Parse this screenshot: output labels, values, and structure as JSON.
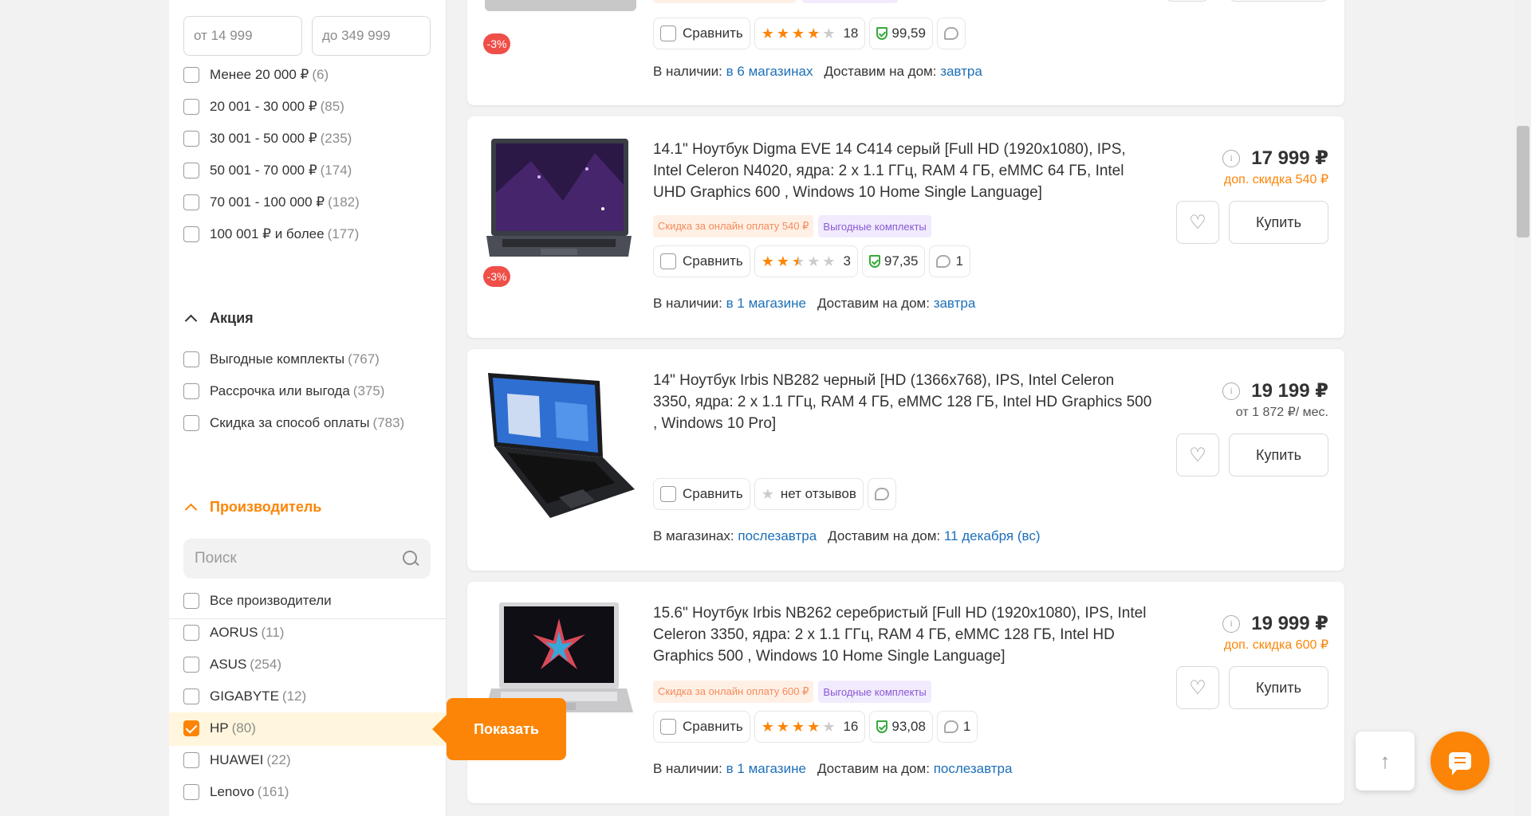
{
  "filters": {
    "price_from_placeholder": "от 14 999",
    "price_to_placeholder": "до 349 999",
    "price_ranges": [
      {
        "label": "Менее 20 000 ₽",
        "count": "(6)"
      },
      {
        "label": "20 001 - 30 000 ₽",
        "count": "(85)"
      },
      {
        "label": "30 001 - 50 000 ₽",
        "count": "(235)"
      },
      {
        "label": "50 001 - 70 000 ₽",
        "count": "(174)"
      },
      {
        "label": "70 001 - 100 000 ₽",
        "count": "(182)"
      },
      {
        "label": "100 001 ₽ и более",
        "count": "(177)"
      }
    ],
    "promo": {
      "title": "Акция",
      "items": [
        {
          "label": "Выгодные комплекты",
          "count": "(767)"
        },
        {
          "label": "Рассрочка или выгода",
          "count": "(375)"
        },
        {
          "label": "Скидка за способ оплаты",
          "count": "(783)"
        }
      ]
    },
    "brand": {
      "title": "Производитель",
      "search_placeholder": "Поиск",
      "all_label": "Все производители",
      "items": [
        {
          "label": "AORUS",
          "count": "(11)",
          "checked": false
        },
        {
          "label": "ASUS",
          "count": "(254)",
          "checked": false
        },
        {
          "label": "GIGABYTE",
          "count": "(12)",
          "checked": false
        },
        {
          "label": "HP",
          "count": "(80)",
          "checked": true
        },
        {
          "label": "HUAWEI",
          "count": "(22)",
          "checked": false
        },
        {
          "label": "Lenovo",
          "count": "(161)",
          "checked": false
        }
      ]
    },
    "show_button": "Показать"
  },
  "products": [
    {
      "discount_badge": "-3%",
      "compare_label": "Сравнить",
      "rating": 4,
      "reviews": "18",
      "reliability": "99,59",
      "availability_prefix": "В наличии:",
      "availability_link": "в 6 магазинах",
      "delivery_prefix": "Доставим на дом:",
      "delivery_link": "завтра"
    },
    {
      "title": "14.1\" Ноутбук Digma EVE 14 C414 серый [Full HD (1920x1080), IPS, Intel Celeron N4020, ядра: 2 х 1.1 ГГц, RAM 4 ГБ, eMMC 64 ГБ, Intel UHD Graphics 600 , Windows 10 Home Single Language]",
      "tag_promo": "Скидка за онлайн оплату 540 ₽",
      "tag_bundle": "Выгодные комплекты",
      "discount_badge": "-3%",
      "compare_label": "Сравнить",
      "rating": 2.5,
      "reviews": "3",
      "reliability": "97,35",
      "comments": "1",
      "availability_prefix": "В наличии:",
      "availability_link": "в 1 магазине",
      "delivery_prefix": "Доставим на дом:",
      "delivery_link": "завтра",
      "price": "17 999 ₽",
      "price_note": "доп. скидка 540 ₽",
      "buy_label": "Купить"
    },
    {
      "title": "14\" Ноутбук Irbis NB282 черный [HD (1366x768), IPS, Intel Celeron 3350, ядра: 2 х 1.1 ГГц, RAM 4 ГБ, eMMC 128 ГБ, Intel HD Graphics 500 , Windows 10 Pro]",
      "compare_label": "Сравнить",
      "no_reviews": "нет отзывов",
      "availability_prefix": "В магазинах:",
      "availability_link": "послезавтра",
      "delivery_prefix": "Доставим на дом:",
      "delivery_link": "11 декабря (вс)",
      "price": "19 199 ₽",
      "price_note": "от 1 872 ₽/ мес.",
      "buy_label": "Купить"
    },
    {
      "title": "15.6\" Ноутбук Irbis NB262 серебристый [Full HD (1920x1080), IPS, Intel Celeron 3350, ядра: 2 х 1.1 ГГц, RAM 4 ГБ, eMMC 128 ГБ, Intel HD Graphics 500 , Windows 10 Home Single Language]",
      "tag_promo": "Скидка за онлайн оплату 600 ₽",
      "tag_bundle": "Выгодные комплекты",
      "compare_label": "Сравнить",
      "rating": 4,
      "reviews": "16",
      "reliability": "93,08",
      "comments": "1",
      "availability_prefix": "В наличии:",
      "availability_link": "в 1 магазине",
      "delivery_prefix": "Доставим на дом:",
      "delivery_link": "послезавтра",
      "price": "19 999 ₽",
      "price_note": "доп. скидка 600 ₽",
      "buy_label": "Купить"
    }
  ],
  "icons": {
    "info": "i",
    "heart": "♡",
    "arrow_up": "↑"
  },
  "colors": {
    "accent": "#fc8507",
    "link": "#1d6fb8",
    "discount_badge": "#f04e48",
    "promo_tag_text": "#f58b5a",
    "bundle_tag_text": "#8a5ad6",
    "reliability_green": "#37a93b"
  }
}
